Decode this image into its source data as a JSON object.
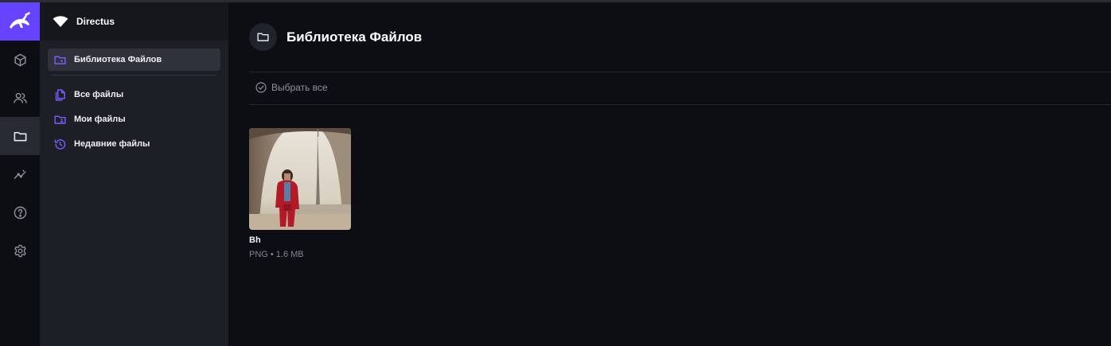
{
  "project": {
    "name": "Directus"
  },
  "modules": [
    {
      "icon": "cube-icon",
      "name": "content"
    },
    {
      "icon": "users-icon",
      "name": "user-directory"
    },
    {
      "icon": "folder-icon",
      "name": "file-library",
      "active": true
    },
    {
      "icon": "insights-icon",
      "name": "insights"
    },
    {
      "icon": "help-icon",
      "name": "help"
    },
    {
      "icon": "settings-icon",
      "name": "settings"
    }
  ],
  "nav": {
    "items": [
      {
        "label": "Библиотека Файлов",
        "icon": "folder-special-icon",
        "active": true
      },
      {
        "label": "Все файлы",
        "icon": "files-icon"
      },
      {
        "label": "Мои файлы",
        "icon": "folder-user-icon"
      },
      {
        "label": "Недавние файлы",
        "icon": "history-icon"
      }
    ]
  },
  "header": {
    "title": "Библиотека Файлов"
  },
  "toolbar": {
    "select_all_label": "Выбрать все"
  },
  "files": [
    {
      "title": "Bh",
      "type": "PNG",
      "size": "1.6 MB",
      "meta": "PNG • 1.6 MB"
    }
  ],
  "colors": {
    "accent": "#6644ff",
    "accent_light": "#7a5cff",
    "nav_bg": "#1c1f26",
    "main_bg": "#0c0e14"
  }
}
